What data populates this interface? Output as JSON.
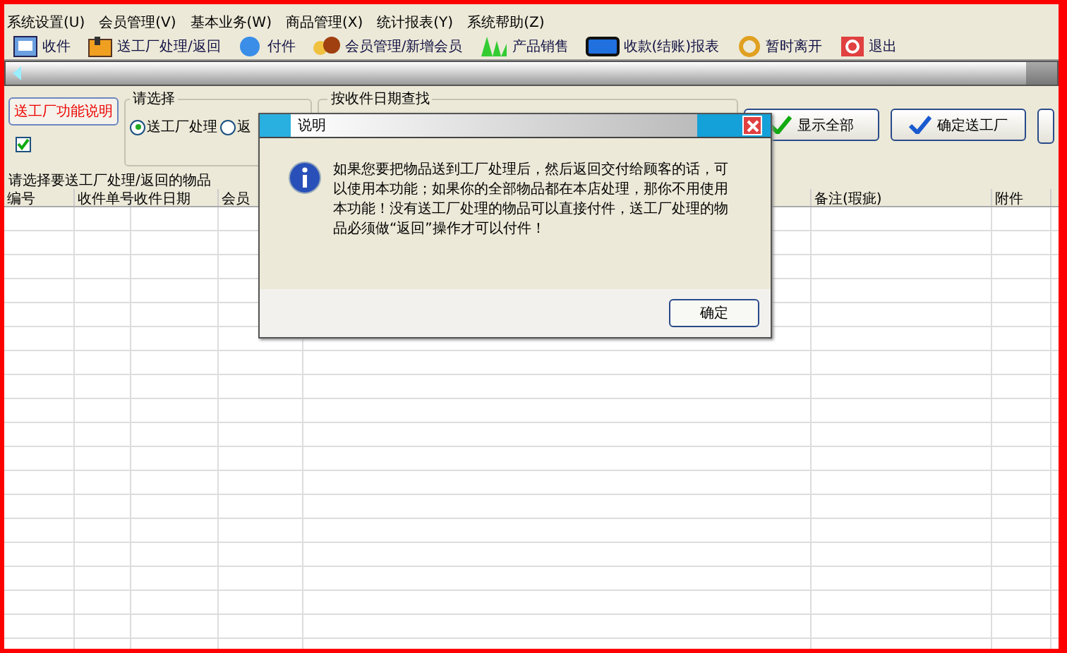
{
  "menu": [
    "系统设置(U)",
    "会员管理(V)",
    "基本业务(W)",
    "商品管理(X)",
    "统计报表(Y)",
    "系统帮助(Z)"
  ],
  "toolbar": [
    {
      "label": "收件",
      "kind": "doc"
    },
    {
      "label": "送工厂处理/返回",
      "kind": "factory"
    },
    {
      "label": "付件",
      "kind": "globe"
    },
    {
      "label": "会员管理/新增会员",
      "kind": "people"
    },
    {
      "label": "产品销售",
      "kind": "plant"
    },
    {
      "label": "收款(结账)报表",
      "kind": "monitor"
    },
    {
      "label": "暂时离开",
      "kind": "refresh"
    },
    {
      "label": "退出",
      "kind": "exit"
    }
  ],
  "help_button": "送工厂功能说明",
  "checkbox": {
    "checked": true
  },
  "choose_group": {
    "title": "请选择",
    "options": [
      {
        "label": "送工厂处理",
        "selected": true
      },
      {
        "label": "返",
        "selected": false
      }
    ]
  },
  "date_group": {
    "title": "按收件日期查找"
  },
  "buttons": [
    {
      "label": "显示全部",
      "kind": "green"
    },
    {
      "label": "确定送工厂",
      "kind": "blue"
    }
  ],
  "list_title": "请选择要送工厂处理/返回的物品",
  "table": {
    "columns": [
      "编号",
      "收件单号",
      "收件日期",
      "会员",
      "",
      "备注(瑕疵)",
      "附件"
    ]
  },
  "dialog": {
    "title": "说明",
    "message": "如果您要把物品送到工厂处理后，然后返回交付给顾客的话，可以使用本功能；如果你的全部物品都在本店处理，那你不用使用本功能！没有送工厂处理的物品可以直接付件，送工厂处理的物品必须做“返回”操作才可以付件！",
    "ok": "确定"
  }
}
